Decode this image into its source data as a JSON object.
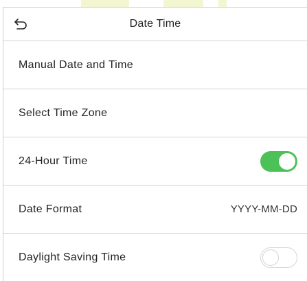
{
  "header": {
    "title": "Date Time",
    "back_icon": "back-arrow-icon"
  },
  "settings": [
    {
      "label": "Manual Date and Time"
    },
    {
      "label": "Select Time Zone"
    },
    {
      "label": "24-Hour Time",
      "toggle": true
    },
    {
      "label": "Date Format",
      "value": "YYYY-MM-DD"
    },
    {
      "label": "Daylight Saving Time",
      "toggle": false
    }
  ],
  "colors": {
    "toggle_on": "#4cc158",
    "toggle_off_border": "#d4d4d4"
  }
}
